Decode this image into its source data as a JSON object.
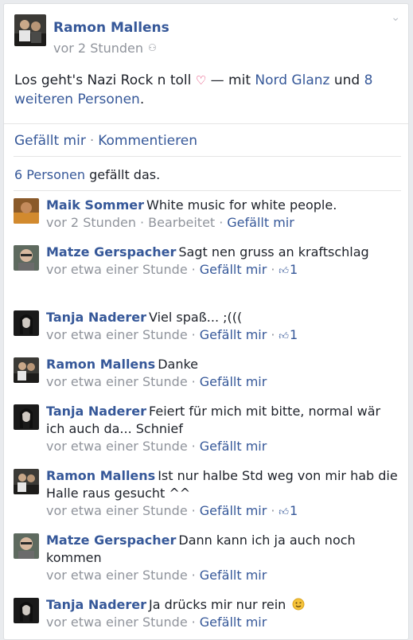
{
  "post": {
    "author": "Ramon Mallens",
    "time": "vor 2 Stunden",
    "text_main": "Los geht's Nazi Rock n toll",
    "with_label": "— mit",
    "tagged": "Nord Glanz",
    "and_label": "und",
    "others": "8 weiteren Personen",
    "period": "."
  },
  "actions": {
    "like": "Gefällt mir",
    "separator": "·",
    "comment": "Kommentieren"
  },
  "likes": {
    "count": "6 Personen",
    "rest": "gefällt das."
  },
  "comments": [
    {
      "name": "Maik Sommer",
      "text": "White music for white people.",
      "time": "vor 2 Stunden",
      "extra": "Bearbeitet",
      "like": "Gefällt mir",
      "likes": ""
    },
    {
      "name": "Matze Gerspacher",
      "text": "Sagt nen gruss an kraftschlag",
      "time": "vor etwa einer Stunde",
      "extra": "",
      "like": "Gefällt mir",
      "likes": "1"
    },
    {
      "name": "Tanja Naderer",
      "text": "Viel spaß... ;(((",
      "time": "vor etwa einer Stunde",
      "extra": "",
      "like": "Gefällt mir",
      "likes": "1"
    },
    {
      "name": "Ramon Mallens",
      "text": "Danke",
      "time": "vor etwa einer Stunde",
      "extra": "",
      "like": "Gefällt mir",
      "likes": ""
    },
    {
      "name": "Tanja Naderer",
      "text": "Feiert für mich mit bitte, normal wär ich auch da... Schnief",
      "time": "vor etwa einer Stunde",
      "extra": "",
      "like": "Gefällt mir",
      "likes": ""
    },
    {
      "name": "Ramon Mallens",
      "text": "Ist nur halbe Std weg von mir hab die Halle raus gesucht ^^",
      "time": "vor etwa einer Stunde",
      "extra": "",
      "like": "Gefällt mir",
      "likes": "1"
    },
    {
      "name": "Matze Gerspacher",
      "text": "Dann kann ich ja auch noch kommen",
      "time": "vor etwa einer Stunde",
      "extra": "",
      "like": "Gefällt mir",
      "likes": ""
    },
    {
      "name": "Tanja Naderer",
      "text": "Ja drücks mir nur rein",
      "time": "vor etwa einer Stunde",
      "extra": "",
      "like": "Gefällt mir",
      "likes": ""
    }
  ],
  "icons": {
    "audience": "friends-icon",
    "menu": "chevron-down-icon",
    "heart": "heart-icon",
    "thumb": "thumbs-up-icon",
    "smiley": "smiley-icon"
  },
  "colors": {
    "link": "#365899",
    "meta": "#90949c",
    "text": "#1d2129",
    "background": "#e9ebee"
  }
}
